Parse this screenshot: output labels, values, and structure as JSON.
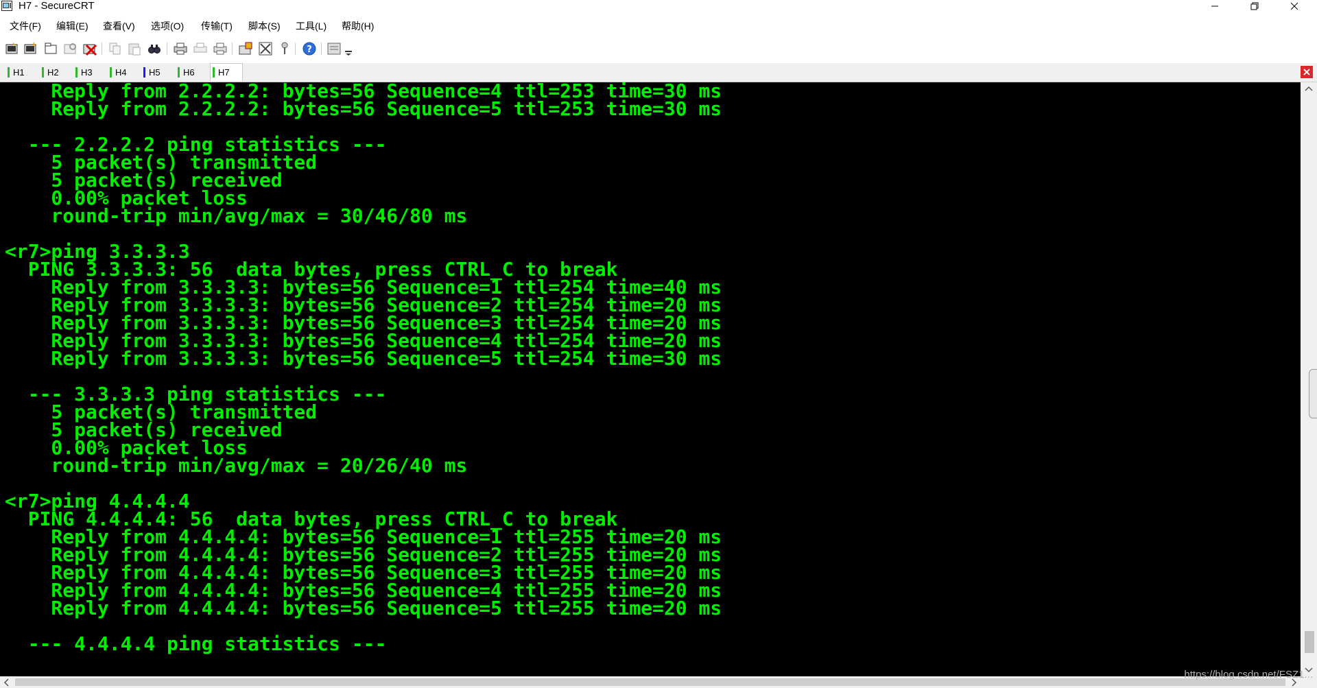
{
  "window": {
    "title": "H7 - SecureCRT"
  },
  "menu": {
    "items": [
      "文件(F)",
      "编辑(E)",
      "查看(V)",
      "选项(O)",
      "传输(T)",
      "脚本(S)",
      "工具(L)",
      "帮助(H)"
    ]
  },
  "toolbar": {
    "icons": [
      "connect-icon",
      "quick-connect-icon",
      "connect-in-tab-icon",
      "reconnect-icon",
      "disconnect-icon",
      "copy-icon",
      "paste-icon",
      "find-icon",
      "print-icon",
      "print-selection-icon",
      "print-screen-icon",
      "session-options-icon",
      "global-options-icon",
      "keymap-icon",
      "help-icon",
      "sftp-icon"
    ]
  },
  "tabs": {
    "items": [
      {
        "label": "H1",
        "color": "#2eb82e"
      },
      {
        "label": "H2",
        "color": "#2eb82e"
      },
      {
        "label": "H3",
        "color": "#2eb82e"
      },
      {
        "label": "H4",
        "color": "#2eb82e"
      },
      {
        "label": "H5",
        "color": "#1a1aff"
      },
      {
        "label": "H6",
        "color": "#2eb82e"
      },
      {
        "label": "H7",
        "color": "#2eb82e"
      }
    ],
    "active": "H7"
  },
  "terminal": {
    "foreground": "#00ee00",
    "background": "#000000",
    "lines": [
      "    Reply from 2.2.2.2: bytes=56 Sequence=4 ttl=253 time=30 ms",
      "    Reply from 2.2.2.2: bytes=56 Sequence=5 ttl=253 time=30 ms",
      "",
      "  --- 2.2.2.2 ping statistics ---",
      "    5 packet(s) transmitted",
      "    5 packet(s) received",
      "    0.00% packet loss",
      "    round-trip min/avg/max = 30/46/80 ms",
      "",
      "<r7>ping 3.3.3.3",
      "  PING 3.3.3.3: 56  data bytes, press CTRL_C to break",
      "    Reply from 3.3.3.3: bytes=56 Sequence=1 ttl=254 time=40 ms",
      "    Reply from 3.3.3.3: bytes=56 Sequence=2 ttl=254 time=20 ms",
      "    Reply from 3.3.3.3: bytes=56 Sequence=3 ttl=254 time=20 ms",
      "    Reply from 3.3.3.3: bytes=56 Sequence=4 ttl=254 time=20 ms",
      "    Reply from 3.3.3.3: bytes=56 Sequence=5 ttl=254 time=30 ms",
      "",
      "  --- 3.3.3.3 ping statistics ---",
      "    5 packet(s) transmitted",
      "    5 packet(s) received",
      "    0.00% packet loss",
      "    round-trip min/avg/max = 20/26/40 ms",
      "",
      "<r7>ping 4.4.4.4",
      "  PING 4.4.4.4: 56  data bytes, press CTRL_C to break",
      "    Reply from 4.4.4.4: bytes=56 Sequence=1 ttl=255 time=20 ms",
      "    Reply from 4.4.4.4: bytes=56 Sequence=2 ttl=255 time=20 ms",
      "    Reply from 4.4.4.4: bytes=56 Sequence=3 ttl=255 time=20 ms",
      "    Reply from 4.4.4.4: bytes=56 Sequence=4 ttl=255 time=20 ms",
      "    Reply from 4.4.4.4: bytes=56 Sequence=5 ttl=255 time=20 ms",
      "",
      "  --- 4.4.4.4 ping statistics ---"
    ]
  },
  "watermark": {
    "text": "https://blog.csdn.net/FSZ1..."
  }
}
